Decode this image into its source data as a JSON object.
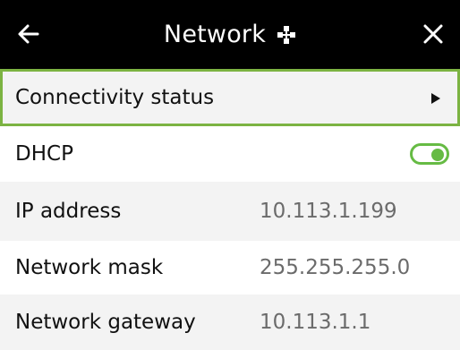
{
  "header": {
    "back_icon": "arrow-left-icon",
    "title": "Network",
    "title_icon": "network-nodes-icon",
    "close_icon": "close-icon"
  },
  "rows": {
    "connectivity": {
      "label": "Connectivity status",
      "icon": "triangle-right-icon"
    },
    "dhcp": {
      "label": "DHCP",
      "enabled": true
    },
    "ip": {
      "label": "IP address",
      "value": "10.113.1.199"
    },
    "mask": {
      "label": "Network mask",
      "value": "255.255.255.0"
    },
    "gateway": {
      "label": "Network gateway",
      "value": "10.113.1.1"
    }
  },
  "colors": {
    "header_bg": "#000000",
    "accent_green": "#7cb342",
    "toggle_green": "#66bb44",
    "row_alt_bg": "#f3f3f3",
    "value_text": "#6b6b6b"
  }
}
